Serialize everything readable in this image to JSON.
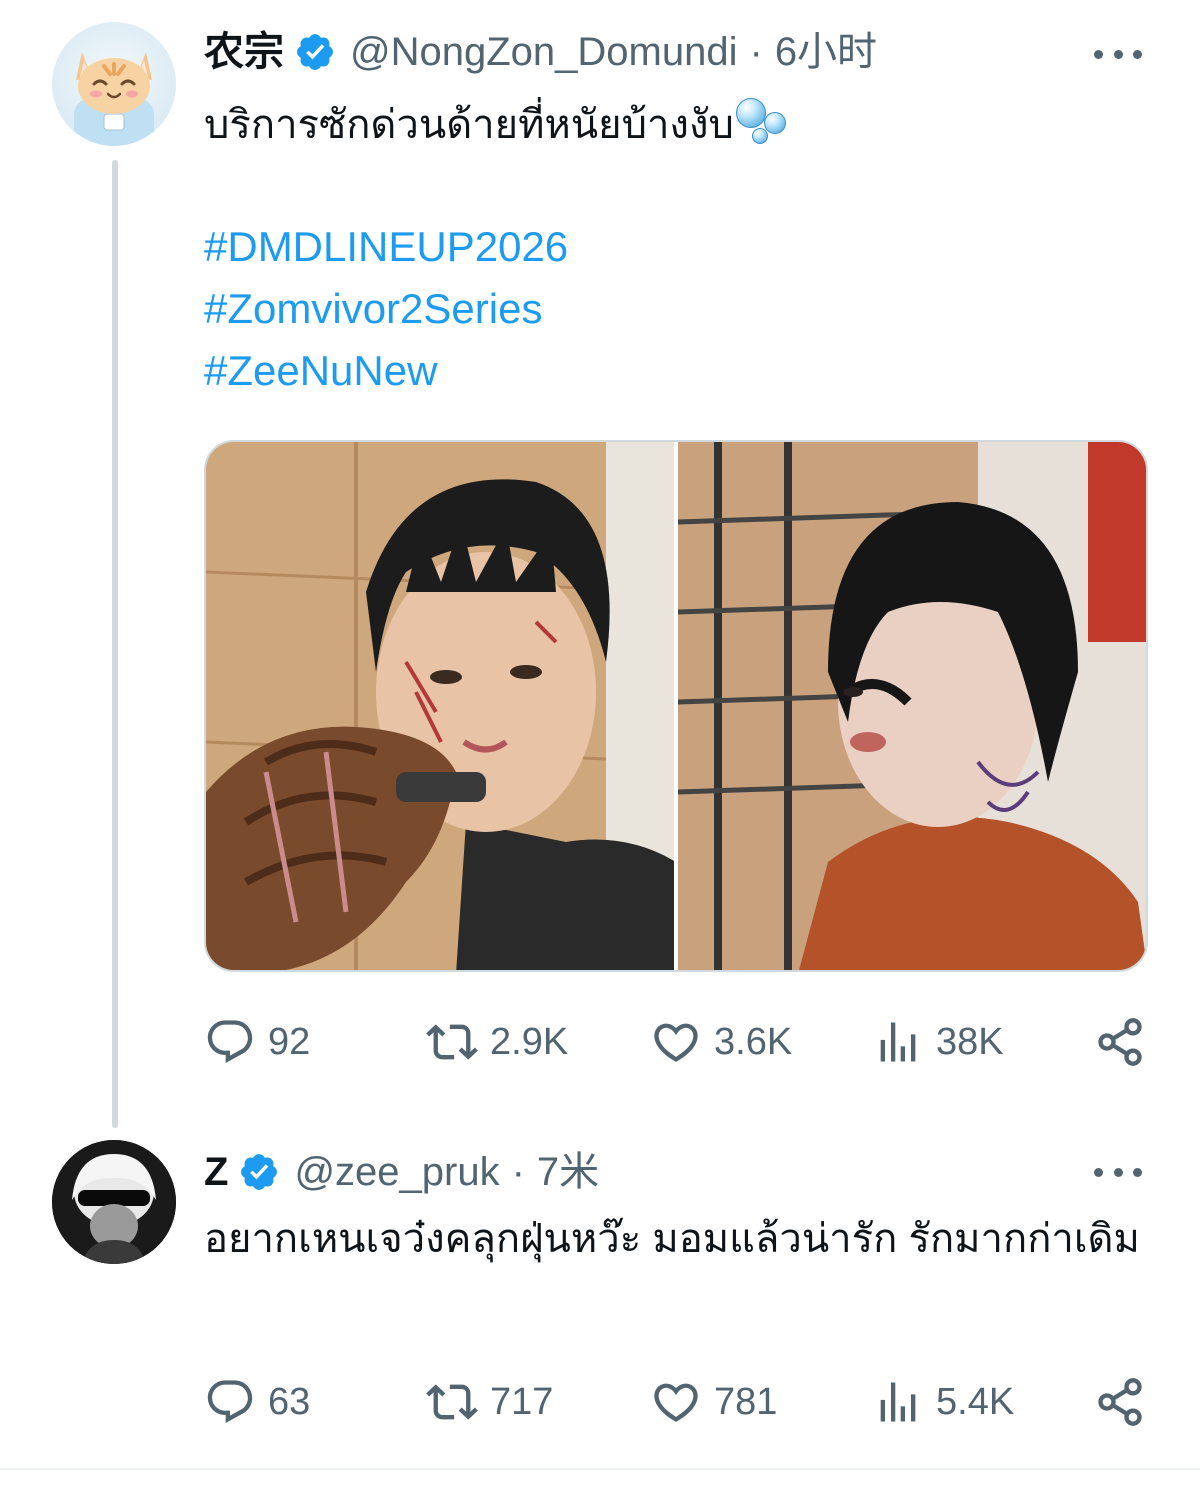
{
  "thread": [
    {
      "author": {
        "name": "农宗",
        "handle": "@NongZon_Domundi",
        "verified": true
      },
      "time": "6小时",
      "text": "บริการซักด่วนด้ายที่หนัยบ้างงับ",
      "text_emoji": "bubbles-emoji",
      "hashtags": [
        "#DMDLINEUP2026",
        "#Zomvivor2Series",
        "#ZeeNuNew"
      ],
      "media_count": 2,
      "stats": {
        "replies": "92",
        "reposts": "2.9K",
        "likes": "3.6K",
        "views": "38K"
      }
    },
    {
      "author": {
        "name": "Z",
        "handle": "@zee_pruk",
        "verified": true
      },
      "time": "7米",
      "text": "อยากเหนเจว๋งคลุกฝุ่นหว๊ะ มอมแล้วน่ารัก รักมากก่าเดิม",
      "stats": {
        "replies": "63",
        "reposts": "717",
        "likes": "781",
        "views": "5.4K"
      }
    }
  ],
  "colors": {
    "link": "#1d9bf0",
    "secondary_text": "#536471",
    "primary_text": "#0f1419",
    "verified_badge": "#1d9bf0",
    "thread_line": "#cfd9de"
  },
  "icons": [
    "more-icon",
    "verified-badge-icon",
    "reply-icon",
    "repost-icon",
    "like-icon",
    "views-icon",
    "share-icon"
  ]
}
